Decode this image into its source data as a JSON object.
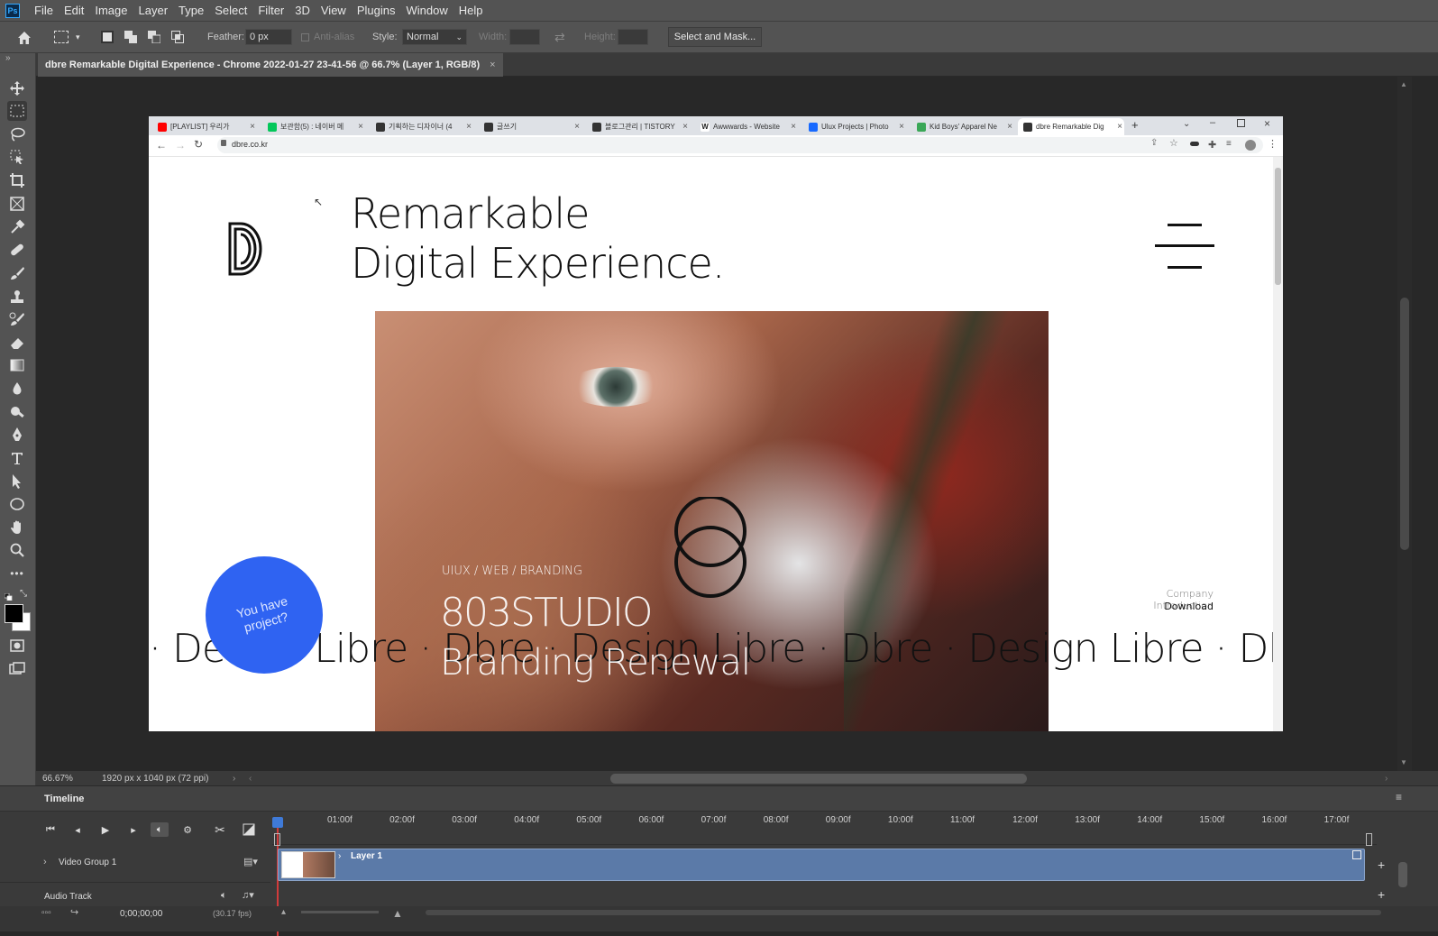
{
  "app": {
    "logo": "Ps",
    "menu": [
      "File",
      "Edit",
      "Image",
      "Layer",
      "Type",
      "Select",
      "Filter",
      "3D",
      "View",
      "Plugins",
      "Window",
      "Help"
    ]
  },
  "options": {
    "feather_label": "Feather:",
    "feather_value": "0 px",
    "antialias_label": "Anti-alias",
    "style_label": "Style:",
    "style_value": "Normal",
    "width_label": "Width:",
    "height_label": "Height:",
    "select_mask_label": "Select and Mask..."
  },
  "document": {
    "tab_title": "dbre Remarkable Digital Experience - Chrome 2022-01-27 23-41-56 @ 66.7% (Layer 1, RGB/8)",
    "tab_close": "×"
  },
  "browser": {
    "tabs": [
      {
        "label": "[PLAYLIST] 우리가",
        "color": "#ff0000"
      },
      {
        "label": "보관함(5) : 네이버 메",
        "color": "#03c75a"
      },
      {
        "label": "기획하는 디자이너 (4",
        "color": "#333333"
      },
      {
        "label": "글쓰기",
        "color": "#333333"
      },
      {
        "label": "블로그관리 | TISTORY",
        "color": "#333333"
      },
      {
        "label": "Awwwards - Website",
        "color": "#222222"
      },
      {
        "label": "Ulux Projects | Photo",
        "color": "#1769ff"
      },
      {
        "label": "Kid Boys' Apparel Ne",
        "color": "#3aa757"
      },
      {
        "label": "dbre Remarkable Dig",
        "color": "#333333"
      }
    ],
    "new_tab": "+",
    "url": "dbre.co.kr"
  },
  "site": {
    "headline_1": "Remarkable",
    "headline_2": "Digital Experience.",
    "category": "UIUX / WEB / BRANDING",
    "studio": "803STUDIO",
    "project": "Branding Renewal",
    "company_intro": "Company Introduction",
    "download": "Download",
    "project_cta": "You have project?",
    "marquee": "·  Design Libre  ·  Dbre  ·  Design Libre  ·  Dbre  ·  Design Libre  ·  Dbre  ·  D"
  },
  "status": {
    "zoom": "66.67%",
    "doc_info": "1920 px x 1040 px (72 ppi)"
  },
  "timeline": {
    "title": "Timeline",
    "ruler": [
      "01:00f",
      "02:00f",
      "03:00f",
      "04:00f",
      "05:00f",
      "06:00f",
      "07:00f",
      "08:00f",
      "09:00f",
      "10:00f",
      "11:00f",
      "12:00f",
      "13:00f",
      "14:00f",
      "15:00f",
      "16:00f",
      "17:00f"
    ],
    "video_group": "Video Group 1",
    "layer_name": "Layer 1",
    "audio_track": "Audio Track",
    "timecode": "0;00;00;00",
    "fps": "(30.17 fps)"
  },
  "colors": {
    "ps_bg": "#535353",
    "canvas_bg": "#282828",
    "accent_blue": "#2f63f2",
    "layer_bar": "#5b7aa8"
  }
}
